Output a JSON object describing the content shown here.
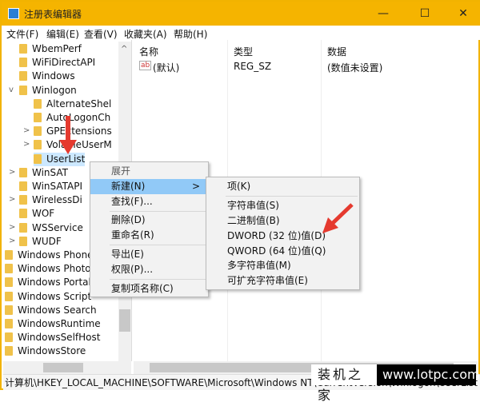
{
  "window": {
    "title": "注册表编辑器",
    "minimize": "—",
    "maximize": "☐",
    "close": "✕"
  },
  "menubar": [
    "文件(F)",
    "编辑(E)",
    "查看(V)",
    "收藏夹(A)",
    "帮助(H)"
  ],
  "tree": [
    {
      "label": "WbemPerf",
      "level": 1
    },
    {
      "label": "WiFiDirectAPI",
      "level": 1
    },
    {
      "label": "Windows",
      "level": 1
    },
    {
      "label": "Winlogon",
      "level": 1,
      "expanded": true
    },
    {
      "label": "AlternateShel",
      "level": 2
    },
    {
      "label": "AutoLogonCh",
      "level": 2
    },
    {
      "label": "GPExtensions",
      "level": 2,
      "expandable": true
    },
    {
      "label": "VolatileUserM",
      "level": 2,
      "expandable": true
    },
    {
      "label": "UserList",
      "level": 2,
      "selected": true
    },
    {
      "label": "WinSAT",
      "level": 1,
      "expandable": true
    },
    {
      "label": "WinSATAPI",
      "level": 1
    },
    {
      "label": "WirelessDi",
      "level": 1,
      "expandable": true
    },
    {
      "label": "WOF",
      "level": 1
    },
    {
      "label": "WSService",
      "level": 1,
      "expandable": true
    },
    {
      "label": "WUDF",
      "level": 1,
      "expandable": true
    },
    {
      "label": "Windows Phone",
      "level": 0
    },
    {
      "label": "Windows Photo",
      "level": 0
    },
    {
      "label": "Windows Portab",
      "level": 0
    },
    {
      "label": "Windows Script",
      "level": 0
    },
    {
      "label": "Windows Search",
      "level": 0
    },
    {
      "label": "WindowsRuntime",
      "level": 0
    },
    {
      "label": "WindowsSelfHost",
      "level": 0
    },
    {
      "label": "WindowsStore",
      "level": 0
    }
  ],
  "columns": [
    "名称",
    "类型",
    "数据"
  ],
  "values": [
    {
      "name": "(默认)",
      "type": "REG_SZ",
      "data": "(数值未设置)"
    }
  ],
  "context_menu": [
    "展开",
    "新建(N)",
    "查找(F)...",
    "删除(D)",
    "重命名(R)",
    "导出(E)",
    "权限(P)...",
    "复制项名称(C)"
  ],
  "submenu_arrow": ">",
  "submenu": [
    "项(K)",
    "字符串值(S)",
    "二进制值(B)",
    "DWORD (32 位)值(D)",
    "QWORD (64 位)值(Q)",
    "多字符串值(M)",
    "可扩充字符串值(E)"
  ],
  "status": "计算机\\HKEY_LOCAL_MACHINE\\SOFTWARE\\Microsoft\\Windows NT\\CurrentVersion\\Winlogon\\UserList",
  "watermark": {
    "cn": "装机之家",
    "url": "www.lotpc.com"
  },
  "colors": {
    "titlebar": "#f5b400",
    "highlight": "#91c9f7",
    "arrow": "#e53a2f"
  }
}
